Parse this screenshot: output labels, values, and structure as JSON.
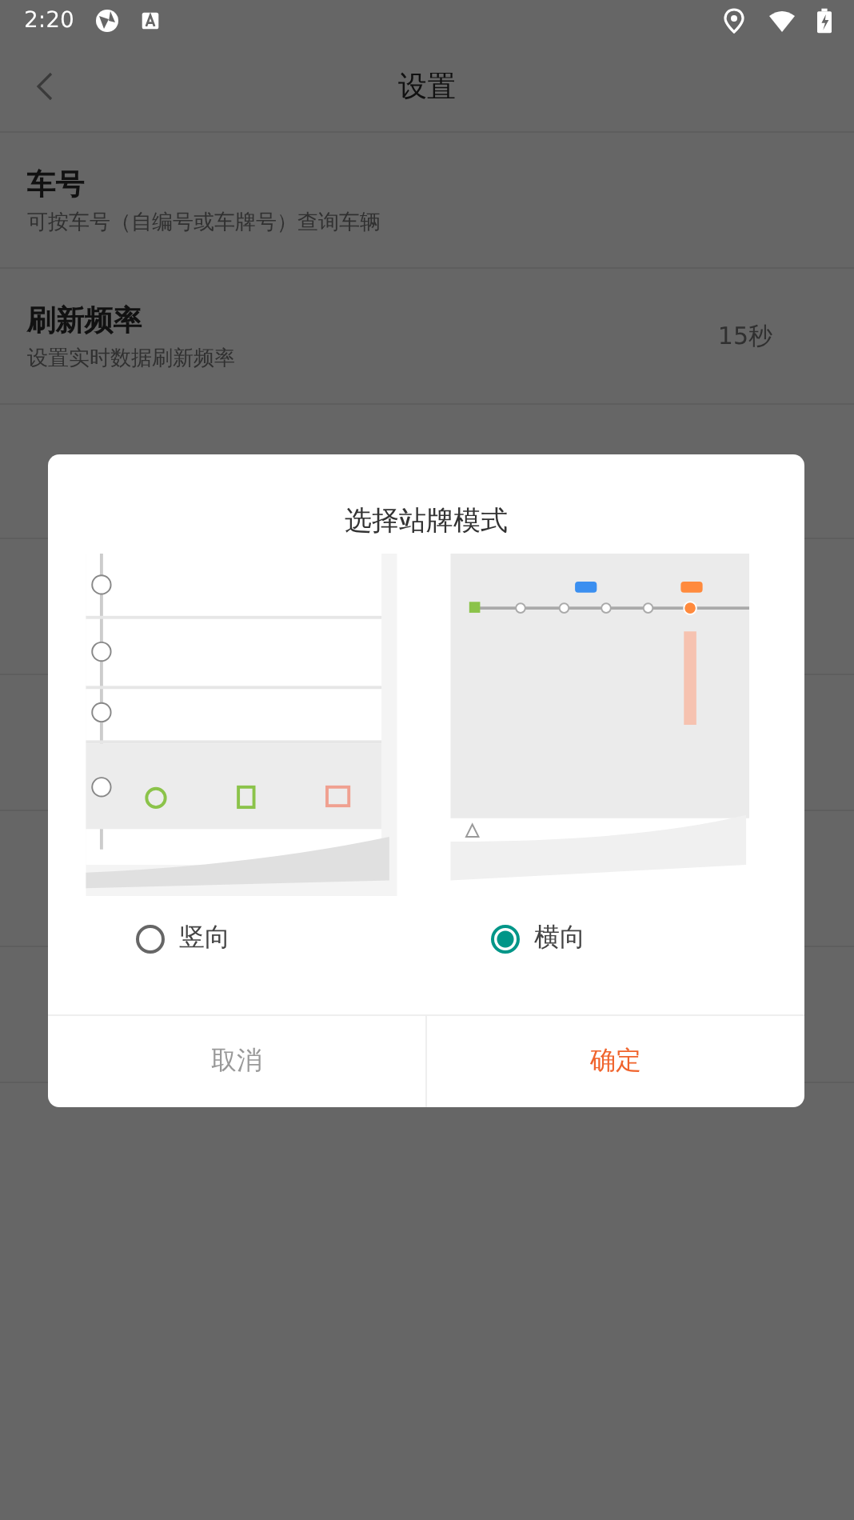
{
  "status_bar": {
    "time": "2:20"
  },
  "header": {
    "title": "设置"
  },
  "settings": [
    {
      "title": "车号",
      "subtitle": "可按车号（自编号或车牌号）查询车辆"
    },
    {
      "title": "刷新频率",
      "subtitle": "设置实时数据刷新频率",
      "value": "15秒"
    }
  ],
  "dialog": {
    "title": "选择站牌模式",
    "options": [
      {
        "label": "竖向",
        "selected": false
      },
      {
        "label": "横向",
        "selected": true
      }
    ],
    "buttons": [
      {
        "label": "取消",
        "kind": "cancel"
      },
      {
        "label": "确定",
        "kind": "confirm"
      }
    ]
  }
}
